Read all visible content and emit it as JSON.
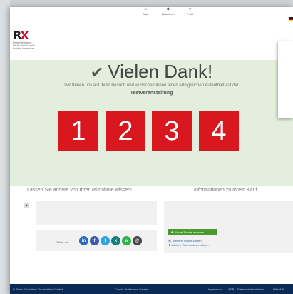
{
  "nav": {
    "items": [
      {
        "label": "Start",
        "icon": "home-icon"
      },
      {
        "label": "Botschein",
        "icon": "ticket-icon"
      },
      {
        "label": "Profil",
        "icon": "user-icon"
      }
    ]
  },
  "logo": {
    "mark_a": "R",
    "mark_b": "X",
    "subtitle": "Reed Exhibitions Deutschland GmbH building businesses"
  },
  "hero": {
    "title": "Vielen Dank!",
    "lead": "Wir freuen uns auf Ihren Besuch und wünschen Ihnen einen erfolgreichen Aufenthalt auf der",
    "event_name": "Testveranstaltung",
    "numbers": [
      "1",
      "2",
      "3",
      "4"
    ],
    "accent_color": "#d8171e",
    "background_color": "#e4eedd"
  },
  "share": {
    "title": "Lassen Sie andere von Ihrer Teilnahme wissen!",
    "label": "Teilen auf:",
    "networks": [
      {
        "name": "linkedin",
        "glyph": "in",
        "color": "#2a6db5"
      },
      {
        "name": "facebook",
        "glyph": "f",
        "color": "#3b5bb0"
      },
      {
        "name": "twitter",
        "glyph": "t",
        "color": "#2aa4e6"
      },
      {
        "name": "xing",
        "glyph": "x",
        "color": "#14807a"
      },
      {
        "name": "whatsapp",
        "glyph": "w",
        "color": "#2fb14b"
      },
      {
        "name": "email",
        "glyph": "@",
        "color": "#444444"
      }
    ]
  },
  "purchase": {
    "title": "Informationen zu Ihrem Kauf",
    "button_label": "Meine Tickets ansehen",
    "links": [
      "Weitere Tickets kaufen",
      "Weitere Ticketcodes einlösen"
    ]
  },
  "footer": {
    "company": "© Reed Exhibitions Deutschland GmbH",
    "cookie": "Cookie Preference Centre",
    "links": [
      "Impressum",
      "AGB",
      "Datenschutzrichtlinie",
      "Hilfe & K"
    ]
  }
}
